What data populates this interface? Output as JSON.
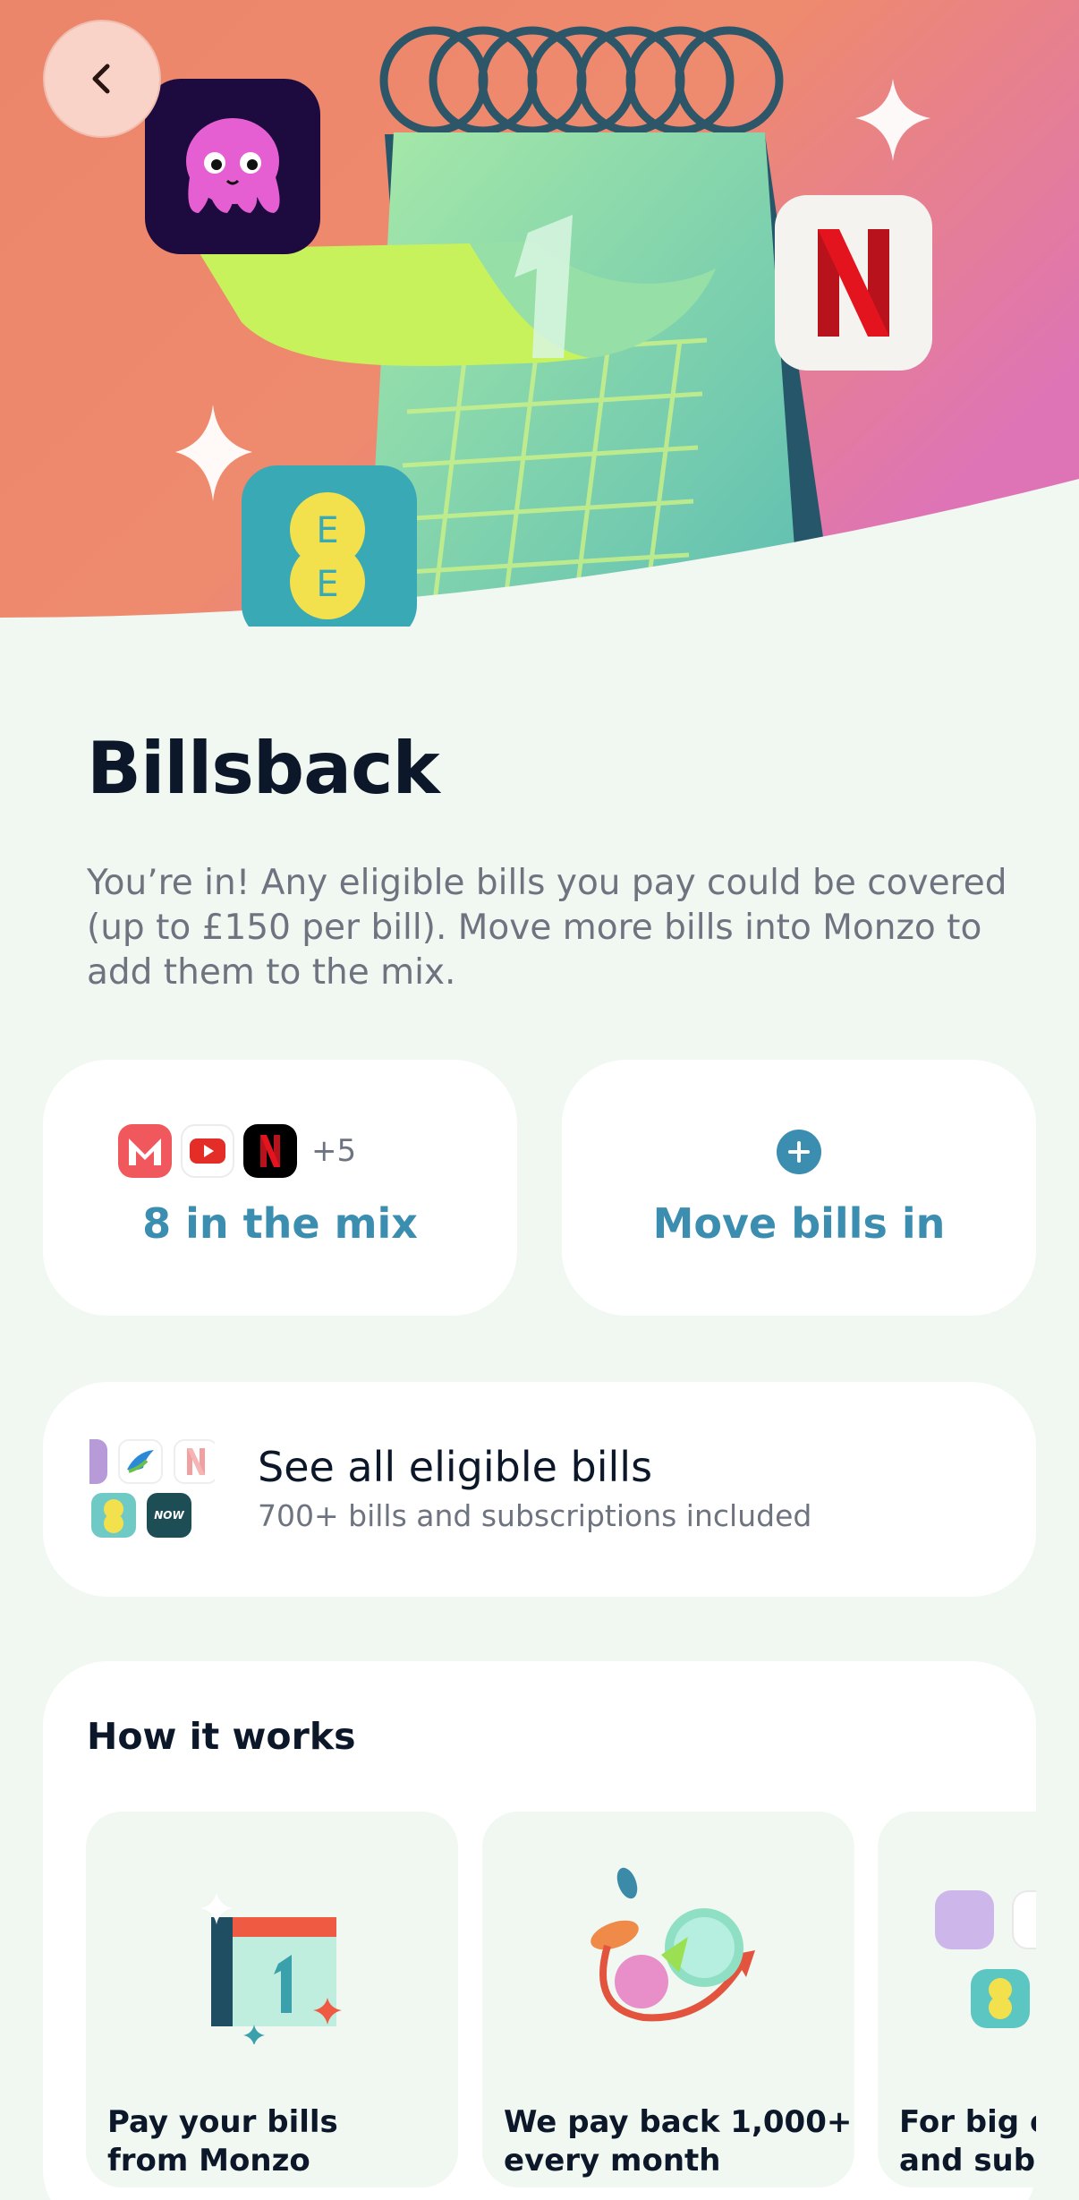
{
  "hero": {
    "back_icon": "chevron-left-icon",
    "colors": {
      "bg_start": "#ee8a6c",
      "bg_end": "#e078b8",
      "calendar": "#7ed7b7",
      "page": "#c7f15c"
    }
  },
  "title": "Billsback",
  "description": "You’re in! Any eligible bills you pay could be covered (up to £150 per bill). Move more bills into Monzo to add them to the mix.",
  "mix_card": {
    "extra_count": "+5",
    "label": "8 in the mix",
    "logos": [
      "monzo-logo",
      "youtube-logo",
      "netflix-logo"
    ]
  },
  "move_card": {
    "label": "Move bills in",
    "icon": "plus-circle-icon"
  },
  "eligible_card": {
    "title": "See all eligible bills",
    "subtitle": "700+ bills and subscriptions included",
    "now_logo_text": "NOW"
  },
  "how_it_works": {
    "title": "How it works",
    "steps": [
      {
        "line1": "Pay your bills",
        "line2": "from Monzo"
      },
      {
        "line1": "We pay back 1,000+",
        "line2": "every month"
      },
      {
        "line1": "For big ones",
        "line2": "and subscriptions"
      }
    ]
  },
  "accent_color": "#3b8eb0"
}
